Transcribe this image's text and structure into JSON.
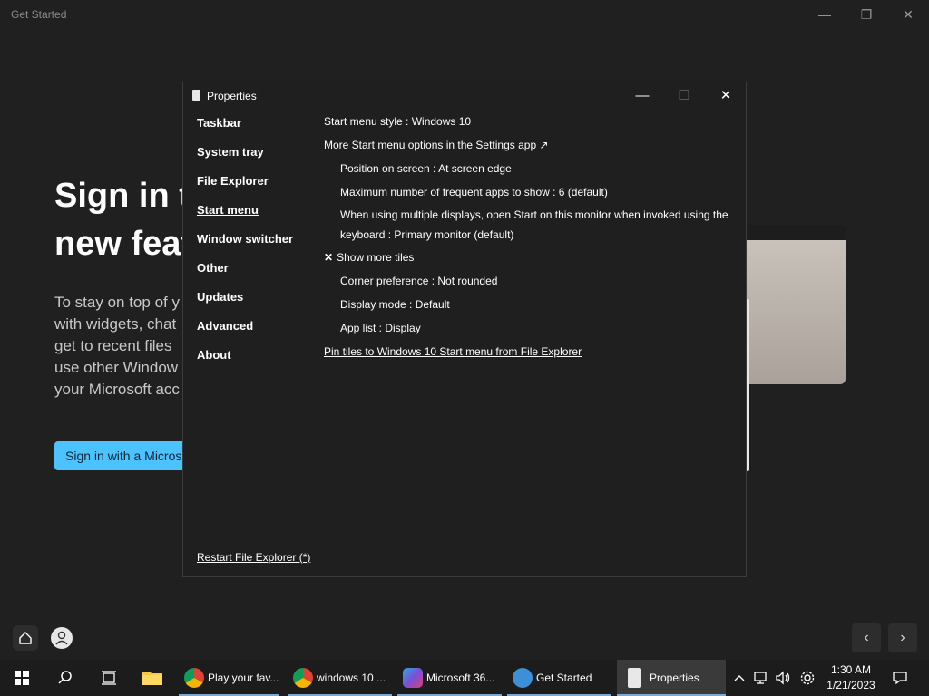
{
  "background_window": {
    "title": "Get Started",
    "minimize": "—",
    "restore": "❐",
    "close": "✕",
    "heading_line1": "Sign in t",
    "heading_line2": "new feat",
    "para_lines": [
      "To stay on top of y",
      "with widgets, chat",
      "get to recent files",
      "use other Window",
      "your Microsoft acc"
    ],
    "signin_button": "Sign in with a Micros",
    "nav_prev": "‹",
    "nav_next": "›"
  },
  "properties": {
    "title": "Properties",
    "minimize": "—",
    "maximize": "☐",
    "close": "✕",
    "nav": [
      {
        "label": "Taskbar",
        "active": false
      },
      {
        "label": "System tray",
        "active": false
      },
      {
        "label": "File Explorer",
        "active": false
      },
      {
        "label": "Start menu",
        "active": true
      },
      {
        "label": "Window switcher",
        "active": false
      },
      {
        "label": "Other",
        "active": false
      },
      {
        "label": "Updates",
        "active": false
      },
      {
        "label": "Advanced",
        "active": false
      },
      {
        "label": "About",
        "active": false
      }
    ],
    "settings": {
      "start_menu_style": "Start menu style : Windows 10",
      "more_options": "More Start menu options in the Settings app ↗",
      "position": "Position on screen : At screen edge",
      "max_frequent": "Maximum number of frequent apps to show : 6 (default)",
      "multi_display": "When using multiple displays, open Start on this monitor when invoked using the keyboard : Primary monitor (default)",
      "show_more_tiles_mark": "✕",
      "show_more_tiles": "Show more tiles",
      "corner_pref": "Corner preference : Not rounded",
      "display_mode": "Display mode : Default",
      "app_list": "App list : Display",
      "pin_tiles": "Pin tiles to Windows 10 Start menu from File Explorer"
    },
    "restart": "Restart File Explorer (*)"
  },
  "taskbar": {
    "apps": [
      {
        "label": "Play your fav...",
        "color": "#dd4b39"
      },
      {
        "label": "windows 10 ...",
        "color": "#dd4b39"
      },
      {
        "label": "Microsoft 36...",
        "color": "#6b5fd6"
      },
      {
        "label": "Get Started",
        "color": "#3d8fd6"
      },
      {
        "label": "Properties",
        "color": "#e8e8e8"
      }
    ],
    "time": "1:30 AM",
    "date": "1/21/2023"
  }
}
